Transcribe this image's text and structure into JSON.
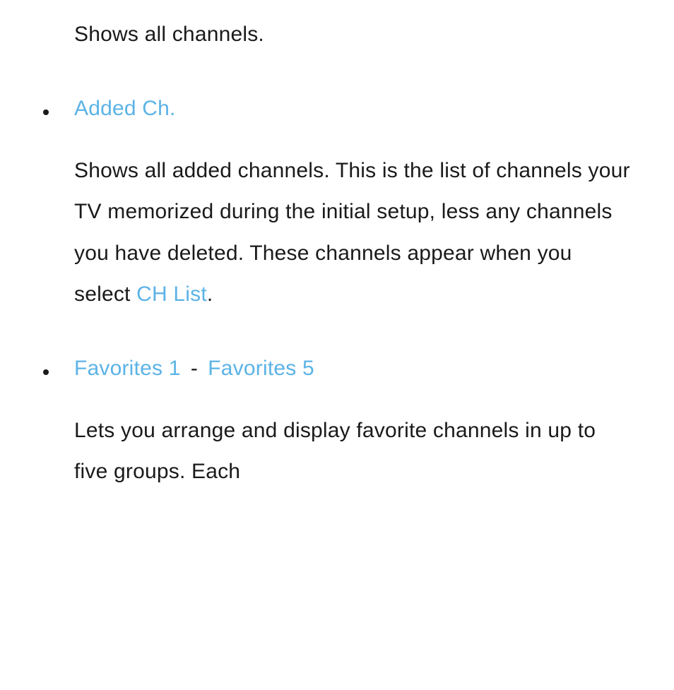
{
  "intro_text": "Shows all channels.",
  "items": [
    {
      "term": "Added Ch.",
      "desc_before": "Shows all added channels. This is the list of channels your TV memorized during the initial setup, less any channels you have deleted. These channels appear when you select ",
      "desc_inline": "CH List",
      "desc_after": "."
    },
    {
      "term_a": "Favorites 1",
      "sep": " - ",
      "term_b": "Favorites 5",
      "desc": "Lets you arrange and display favorite channels in up to five groups. Each"
    }
  ]
}
